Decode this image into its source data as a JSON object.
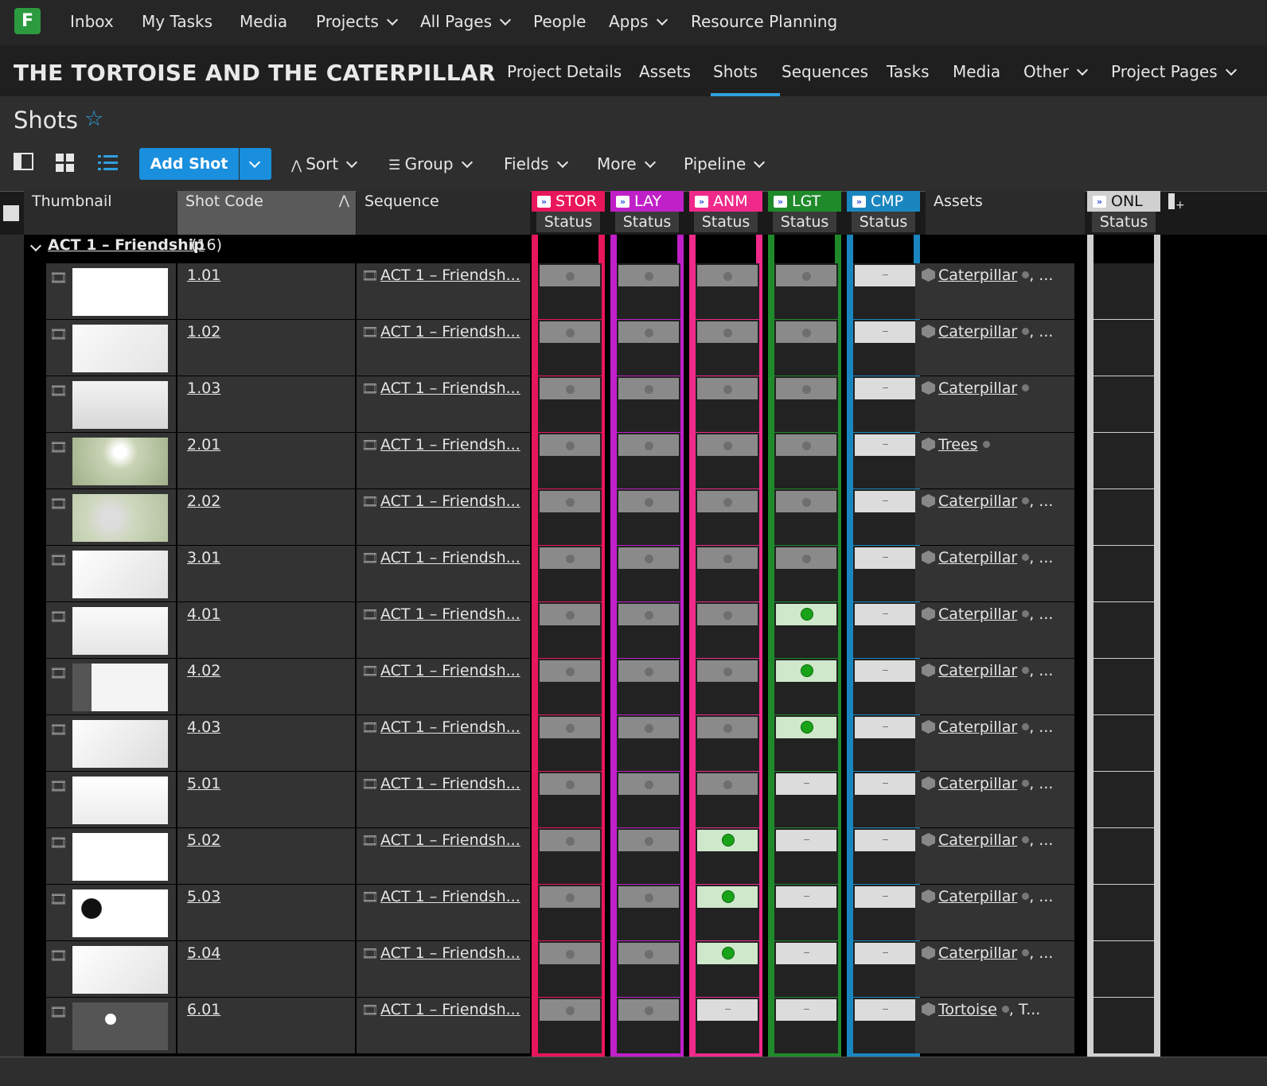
{
  "topnav": {
    "logo": "F",
    "items": [
      "Inbox",
      "My Tasks",
      "Media",
      "Projects",
      "All Pages",
      "People",
      "Apps",
      "Resource Planning"
    ]
  },
  "project": {
    "title": "THE TORTOISE AND THE CATERPILLAR",
    "tabs": [
      "Project Details",
      "Assets",
      "Shots",
      "Sequences",
      "Tasks",
      "Media",
      "Other",
      "Project Pages"
    ],
    "active_tab": "Shots"
  },
  "page": {
    "title": "Shots",
    "star": "☆"
  },
  "toolbar": {
    "add_label": "Add Shot",
    "sort": "Sort",
    "group": "Group",
    "fields": "Fields",
    "more": "More",
    "pipeline": "Pipeline"
  },
  "columns": {
    "thumbnail": "Thumbnail",
    "shot_code": "Shot Code",
    "sequence": "Sequence",
    "assets": "Assets",
    "status_sub": "Status",
    "pipeline": [
      {
        "code": "STOR",
        "color": "#e8165a"
      },
      {
        "code": "LAY",
        "color": "#c020c8"
      },
      {
        "code": "ANM",
        "color": "#f02a8a"
      },
      {
        "code": "LGT",
        "color": "#1f8a2a"
      },
      {
        "code": "CMP",
        "color": "#1a86c0"
      },
      {
        "code": "ONL",
        "color": "#d0d0d0"
      }
    ]
  },
  "group": {
    "label": "ACT 1 – Friendship",
    "count": "(16)"
  },
  "rows": [
    {
      "code": "1.01",
      "sequence": "ACT 1 – Friendsh...",
      "statuses": [
        "dot",
        "dot",
        "dot",
        "dot",
        "dash"
      ],
      "assets": "Caterpillar",
      "more": ", ..."
    },
    {
      "code": "1.02",
      "sequence": "ACT 1 – Friendsh...",
      "statuses": [
        "dot",
        "dot",
        "dot",
        "dot",
        "dash"
      ],
      "assets": "Caterpillar",
      "more": ", ..."
    },
    {
      "code": "1.03",
      "sequence": "ACT 1 – Friendsh...",
      "statuses": [
        "dot",
        "dot",
        "dot",
        "dot",
        "dash"
      ],
      "assets": "Caterpillar",
      "more": ""
    },
    {
      "code": "2.01",
      "sequence": "ACT 1 – Friendsh...",
      "statuses": [
        "dot",
        "dot",
        "dot",
        "dot",
        "dash"
      ],
      "assets": "Trees",
      "more": ""
    },
    {
      "code": "2.02",
      "sequence": "ACT 1 – Friendsh...",
      "statuses": [
        "dot",
        "dot",
        "dot",
        "dot",
        "dash"
      ],
      "assets": "Caterpillar",
      "more": ", ..."
    },
    {
      "code": "3.01",
      "sequence": "ACT 1 – Friendsh...",
      "statuses": [
        "dot",
        "dot",
        "dot",
        "dot",
        "dash"
      ],
      "assets": "Caterpillar",
      "more": ", ..."
    },
    {
      "code": "4.01",
      "sequence": "ACT 1 – Friendsh...",
      "statuses": [
        "dot",
        "dot",
        "dot",
        "green",
        "dash"
      ],
      "assets": "Caterpillar",
      "more": ", ..."
    },
    {
      "code": "4.02",
      "sequence": "ACT 1 – Friendsh...",
      "statuses": [
        "dot",
        "dot",
        "dot",
        "green",
        "dash"
      ],
      "assets": "Caterpillar",
      "more": ", ..."
    },
    {
      "code": "4.03",
      "sequence": "ACT 1 – Friendsh...",
      "statuses": [
        "dot",
        "dot",
        "dot",
        "green",
        "dash"
      ],
      "assets": "Caterpillar",
      "more": ", ..."
    },
    {
      "code": "5.01",
      "sequence": "ACT 1 – Friendsh...",
      "statuses": [
        "dot",
        "dot",
        "dot",
        "dash",
        "dash"
      ],
      "assets": "Caterpillar",
      "more": ", ..."
    },
    {
      "code": "5.02",
      "sequence": "ACT 1 – Friendsh...",
      "statuses": [
        "dot",
        "dot",
        "green",
        "dash",
        "dash"
      ],
      "assets": "Caterpillar",
      "more": ", ..."
    },
    {
      "code": "5.03",
      "sequence": "ACT 1 – Friendsh...",
      "statuses": [
        "dot",
        "dot",
        "green",
        "dash",
        "dash"
      ],
      "assets": "Caterpillar",
      "more": ", ..."
    },
    {
      "code": "5.04",
      "sequence": "ACT 1 – Friendsh...",
      "statuses": [
        "dot",
        "dot",
        "green",
        "dash",
        "dash"
      ],
      "assets": "Caterpillar",
      "more": ", ..."
    },
    {
      "code": "6.01",
      "sequence": "ACT 1 – Friendsh...",
      "statuses": [
        "dot",
        "dot",
        "dash",
        "dash",
        "dash"
      ],
      "assets": "Tortoise",
      "more": ", T..."
    }
  ],
  "icons": {
    "layout_panel": "panel-layout-icon",
    "layout_grid": "grid-view-icon",
    "layout_list": "list-view-icon",
    "film": "film-strip-icon",
    "asset": "asset-cube-icon",
    "sort_arrow": "sort-ascending-icon"
  }
}
